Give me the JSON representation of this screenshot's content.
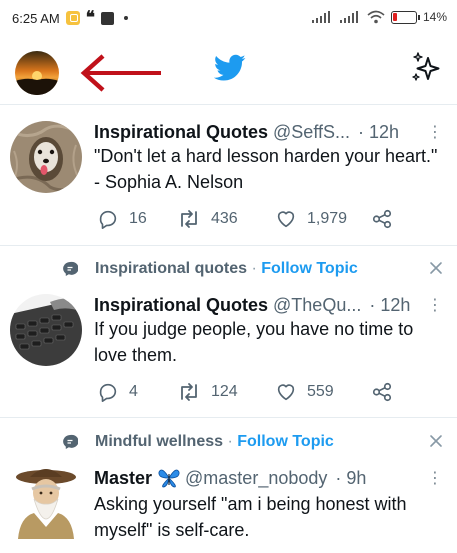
{
  "status_bar": {
    "time": "6:25 AM",
    "battery": "14%"
  },
  "top_bar": {
    "accent": "#1d9bf0",
    "arrow_color": "#c0111a"
  },
  "tweets": [
    {
      "name": "Inspirational Quotes",
      "handle": "@SeffS...",
      "time": "· 12h",
      "text": "\"Don't let a hard lesson harden your heart.\" - Sophia A. Nelson",
      "replies": "16",
      "retweets": "436",
      "likes": "1,979"
    },
    {
      "topic": {
        "name": "Inspirational quotes",
        "dot": " · ",
        "follow": "Follow Topic"
      },
      "name": "Inspirational Quotes",
      "handle": "@TheQu...",
      "time": "· 12h",
      "text": "If you judge people, you have no time to love them.",
      "replies": "4",
      "retweets": "124",
      "likes": "559"
    },
    {
      "topic": {
        "name": "Mindful wellness",
        "dot": " · ",
        "follow": "Follow Topic"
      },
      "name": "Master",
      "handle": "@master_nobody",
      "time": "· 9h",
      "text": "Asking yourself \"am i being honest with myself\" is self-care."
    }
  ]
}
